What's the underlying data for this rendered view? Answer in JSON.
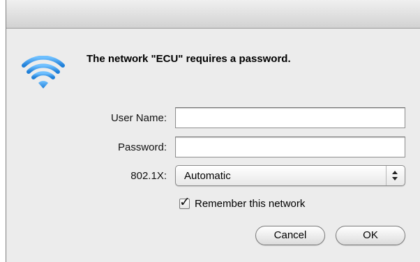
{
  "dialog": {
    "message": "The network \"ECU\" requires a password.",
    "icon": "wifi-icon"
  },
  "form": {
    "username_label": "User Name:",
    "username_value": "",
    "password_label": "Password:",
    "password_value": "",
    "auth_label": "802.1X:",
    "auth_value": "Automatic",
    "remember_label": "Remember this network",
    "remember_checked": true
  },
  "buttons": {
    "cancel": "Cancel",
    "ok": "OK"
  },
  "colors": {
    "wifi": "#3a9be8",
    "dialog_bg": "#ececec"
  }
}
